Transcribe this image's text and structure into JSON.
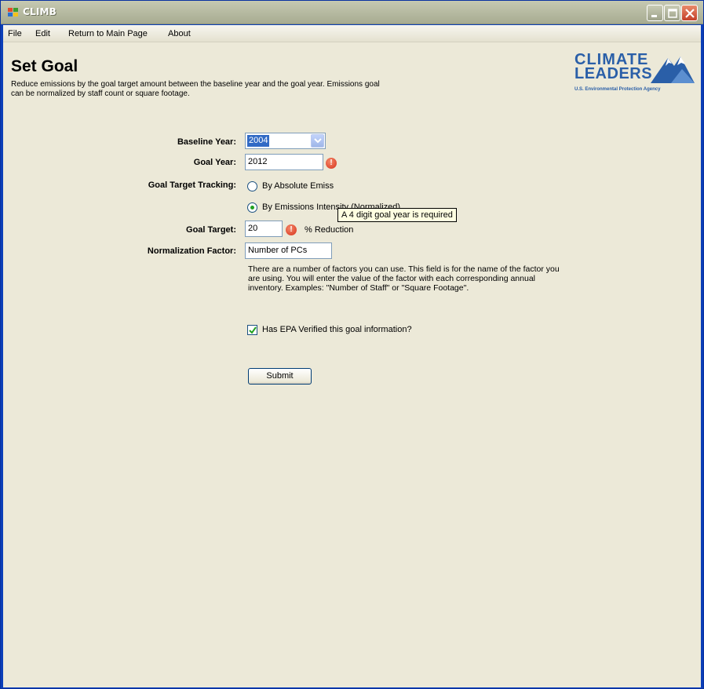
{
  "window": {
    "title": "CLIMB"
  },
  "menu": {
    "items": [
      {
        "label": "File"
      },
      {
        "label": "Edit"
      },
      {
        "label": "Return to Main Page"
      },
      {
        "label": "About"
      }
    ]
  },
  "page": {
    "title": "Set Goal",
    "description": "Reduce emissions by the goal target amount between the baseline year and the goal year. Emissions goal can be normalized by staff count or square footage."
  },
  "logo": {
    "line1": "CLIMATE",
    "line2": "LEADERS",
    "line3": "U.S. Environmental Protection Agency",
    "brand_color": "#2a5fa8"
  },
  "form": {
    "baseline_year": {
      "label": "Baseline Year:",
      "value": "2004"
    },
    "goal_year": {
      "label": "Goal Year:",
      "value": "2012",
      "error_icon": "error-icon"
    },
    "tracking": {
      "label": "Goal Target Tracking:",
      "options": [
        {
          "label": "By Absolute Emiss",
          "selected": false
        },
        {
          "label": "By Emissions Intensity (Normalized)",
          "selected": true
        }
      ]
    },
    "goal_target": {
      "label": "Goal Target:",
      "value": "20",
      "unit": "% Reduction",
      "error_icon": "error-icon"
    },
    "normalization": {
      "label": "Normalization Factor:",
      "value": "Number of PCs",
      "help": "There are a number of factors you can use. This field is for the name of the factor you are using. You will enter the value of the factor with each corresponding annual inventory. Examples: \"Number of Staff\" or \"Square Footage\"."
    },
    "verified": {
      "label": "Has EPA Verified this goal information?",
      "checked": true
    },
    "submit_label": "Submit"
  },
  "tooltip": {
    "text": "A 4 digit goal year is required"
  }
}
